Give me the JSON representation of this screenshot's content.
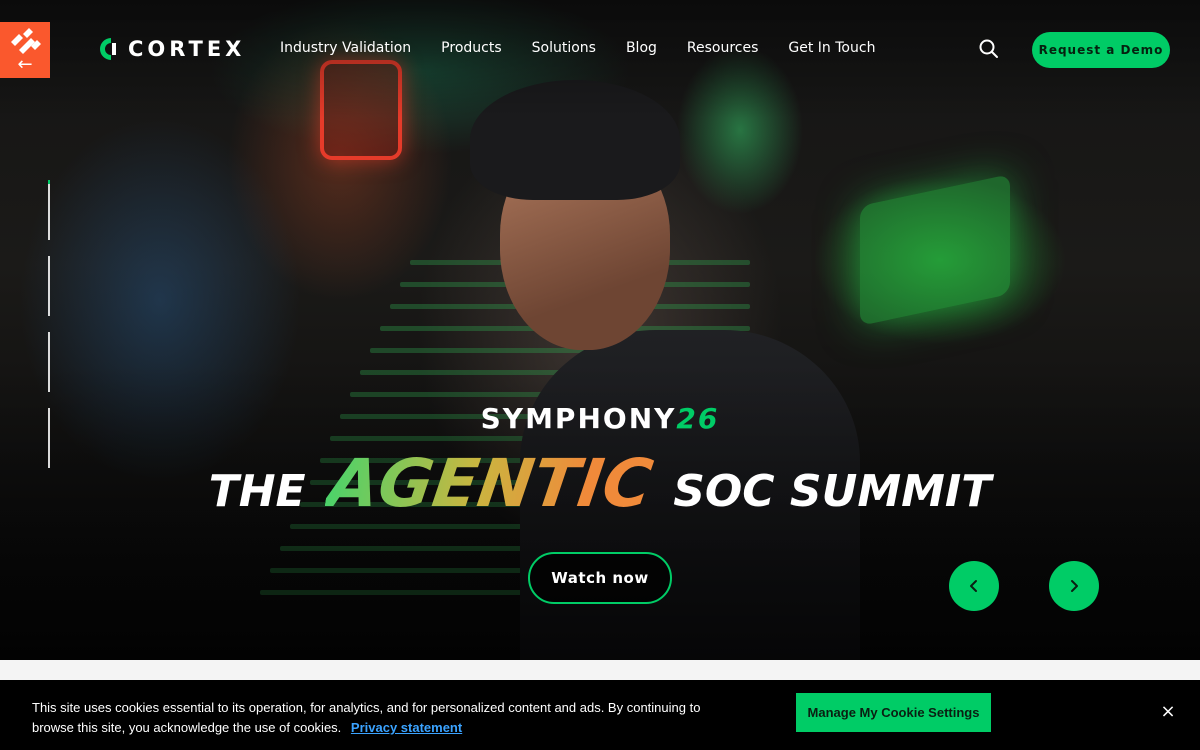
{
  "brand": {
    "name": "CORTEX",
    "accent_color": "#00cc66",
    "parent_badge_color": "#fa582d",
    "parent_badge_icon": "palo-alto-networks-logo",
    "parent_badge_arrow": "←"
  },
  "nav": {
    "items": [
      {
        "label": "Industry Validation"
      },
      {
        "label": "Products"
      },
      {
        "label": "Solutions"
      },
      {
        "label": "Blog"
      },
      {
        "label": "Resources"
      },
      {
        "label": "Get In Touch"
      }
    ],
    "search_icon": "search-icon",
    "cta_label": "Request a Demo"
  },
  "hero": {
    "event_name": "SYMPHONY",
    "event_number": "26",
    "headline_part1": "THE",
    "headline_part2": "AGENTIC",
    "headline_part3": "SOC SUMMIT",
    "cta_label": "Watch now",
    "prev_icon": "chevron-left-icon",
    "next_icon": "chevron-right-icon",
    "slide_count": 4
  },
  "cookie_banner": {
    "text": "This site uses cookies essential to its operation, for analytics, and for personalized content and ads. By continuing to browse this site, you acknowledge the use of cookies.",
    "link_label": "Privacy statement",
    "settings_label": "Manage My Cookie Settings",
    "close_label": "×"
  }
}
